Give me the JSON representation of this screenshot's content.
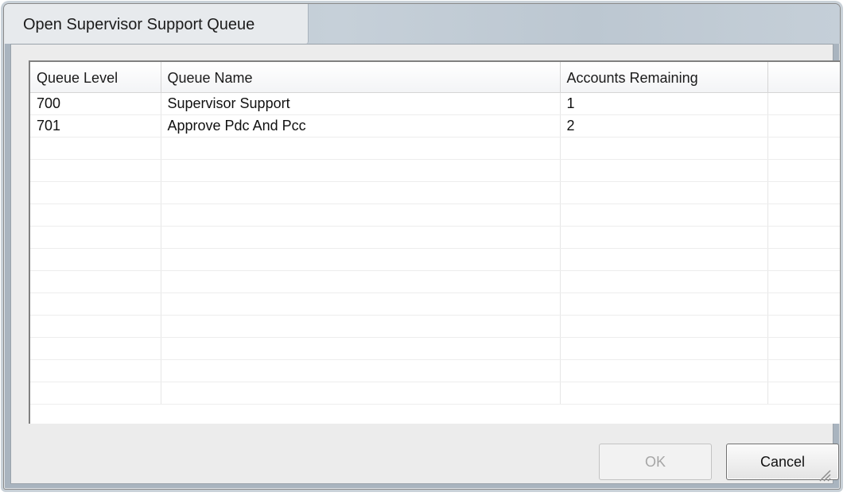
{
  "dialog": {
    "title": "Open Supervisor Support Queue"
  },
  "list": {
    "columns": [
      "Queue Level",
      "Queue Name",
      "Accounts Remaining",
      ""
    ],
    "rows": [
      [
        "700",
        "Supervisor Support",
        "1",
        ""
      ],
      [
        "701",
        "Approve Pdc And Pcc",
        "2",
        ""
      ]
    ]
  },
  "buttons": {
    "ok": "OK",
    "cancel": "Cancel"
  }
}
